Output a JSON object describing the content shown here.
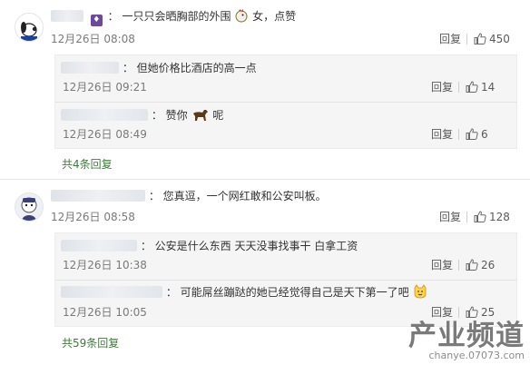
{
  "comments": [
    {
      "separator": "：",
      "text": "一只只会晒胸部的外围",
      "text_after_emoji": "女，点赞",
      "timestamp": "12月26日 08:08",
      "reply_label": "回复",
      "like_count": "450",
      "avatar_icon": "snoopy-avatar-icon",
      "replies": [
        {
          "separator": "：",
          "text": "但她价格比酒店的高一点",
          "timestamp": "12月26日 09:21",
          "reply_label": "回复",
          "like_count": "14"
        },
        {
          "separator": "：",
          "text": "赞你",
          "text_after_emoji": "呢",
          "timestamp": "12月26日 08:49",
          "reply_label": "回复",
          "like_count": "6"
        }
      ],
      "more_label": "共4条回复"
    },
    {
      "separator": "：",
      "text": "您真逗，一个网红敢和公安叫板。",
      "timestamp": "12月26日 08:58",
      "reply_label": "回复",
      "like_count": "128",
      "avatar_icon": "cartoon-avatar-icon",
      "replies": [
        {
          "separator": "：",
          "text": "公安是什么东西 天天没事找事干 白拿工资",
          "timestamp": "12月26日 10:38",
          "reply_label": "回复",
          "like_count": "26"
        },
        {
          "separator": "：",
          "text": "可能屌丝蹦跶的她已经觉得自己是天下第一了吧",
          "timestamp": "12月26日 10:05",
          "reply_label": "回复",
          "like_count": "25"
        }
      ],
      "more_label": "共59条回复"
    }
  ],
  "watermark": {
    "main": "产业频道",
    "sub": "chanye.07073.com"
  },
  "colors": {
    "link_green": "#3d7d3a",
    "reply_bg": "#f5f5f5"
  }
}
